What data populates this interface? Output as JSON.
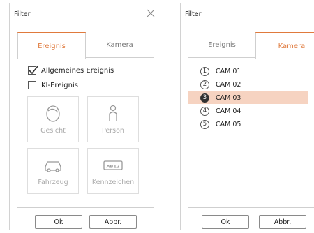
{
  "left": {
    "title": "Filter",
    "tabs": [
      {
        "label": "Ereignis",
        "active": true
      },
      {
        "label": "Kamera",
        "active": false
      }
    ],
    "checks": [
      {
        "label": "Allgemeines Ereignis",
        "checked": true
      },
      {
        "label": "KI-Ereignis",
        "checked": false
      }
    ],
    "tiles": [
      {
        "label": "Gesicht",
        "icon": "face-icon"
      },
      {
        "label": "Person",
        "icon": "person-icon"
      },
      {
        "label": "Fahrzeug",
        "icon": "vehicle-icon"
      },
      {
        "label": "Kennzeichen",
        "icon": "license-plate-icon",
        "plate_text": "AB12"
      }
    ],
    "ok_label": "Ok",
    "cancel_label": "Abbr."
  },
  "right": {
    "title": "Filter",
    "tabs": [
      {
        "label": "Ereignis",
        "active": false
      },
      {
        "label": "Kamera",
        "active": true
      }
    ],
    "cameras": [
      {
        "num": "1",
        "label": "CAM 01",
        "selected": false
      },
      {
        "num": "2",
        "label": "CAM 02",
        "selected": false
      },
      {
        "num": "3",
        "label": "CAM 03",
        "selected": true
      },
      {
        "num": "4",
        "label": "CAM 04",
        "selected": false
      },
      {
        "num": "5",
        "label": "CAM 05",
        "selected": false
      }
    ],
    "ok_label": "Ok",
    "cancel_label": "Abbr."
  },
  "colors": {
    "accent": "#e07a3d",
    "selected_row": "#f6d3c1"
  }
}
